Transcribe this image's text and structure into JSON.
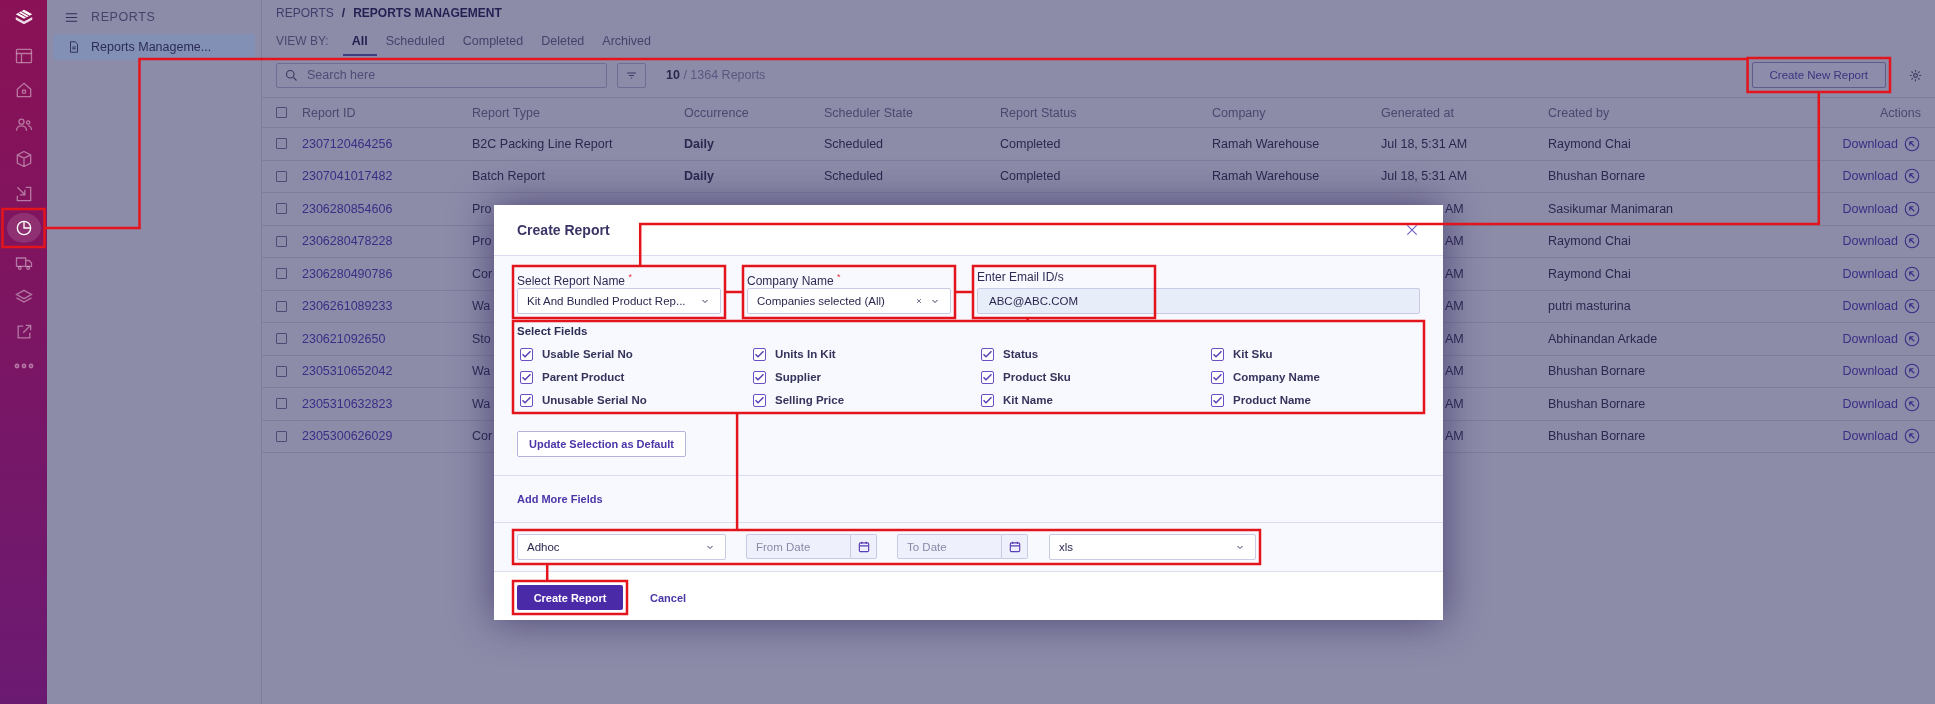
{
  "nav_rail": {
    "icons": [
      {
        "selected": false,
        "highlighted": false
      },
      {
        "selected": false,
        "highlighted": false
      },
      {
        "selected": false,
        "highlighted": false
      },
      {
        "selected": false,
        "highlighted": false
      },
      {
        "selected": false,
        "highlighted": false
      },
      {
        "selected": true,
        "highlighted": true
      },
      {
        "selected": false,
        "highlighted": false
      },
      {
        "selected": false,
        "highlighted": false
      },
      {
        "selected": false,
        "highlighted": false
      },
      {
        "selected": false,
        "highlighted": false
      }
    ]
  },
  "subnav": {
    "title": "REPORTS",
    "items": [
      {
        "label": "Reports Manageme...",
        "selected": true
      }
    ]
  },
  "breadcrumb": {
    "items": [
      "REPORTS",
      "REPORTS MANAGEMENT"
    ],
    "separator": "/"
  },
  "view_by": {
    "label": "VIEW BY:",
    "tabs": [
      {
        "label": "All",
        "selected": true
      },
      {
        "label": "Scheduled",
        "selected": false
      },
      {
        "label": "Completed",
        "selected": false
      },
      {
        "label": "Deleted",
        "selected": false
      },
      {
        "label": "Archived",
        "selected": false
      }
    ]
  },
  "toolbar": {
    "search": {
      "placeholder": "Search here"
    },
    "count": "**10** / 1364 Reports",
    "create_button": {
      "label": "Create New Report",
      "highlighted": true
    }
  },
  "table": {
    "header_checked": false,
    "columns": [
      "Report ID",
      "Report Type",
      "Occurrence",
      "Scheduler State",
      "Report Status",
      "Company",
      "Generated at",
      "Created by",
      "Actions"
    ],
    "rows": [
      {
        "checked": false,
        "covered": false,
        "id": "2307120464256",
        "type": "B2C Packing Line Report",
        "occurrence": "Daily",
        "scheduler_state": "Scheduled",
        "status": "Completed",
        "company": "Ramah Warehouse",
        "generated_at": "Jul 18, 5:31 AM",
        "created_by": "Raymond Chai",
        "action": "Download"
      },
      {
        "checked": false,
        "covered": false,
        "id": "2307041017482",
        "type": "Batch Report",
        "occurrence": "Daily",
        "scheduler_state": "Scheduled",
        "status": "Completed",
        "company": "Ramah Warehouse",
        "generated_at": "Jul 18, 5:31 AM",
        "created_by": "Bhushan Bornare",
        "action": "Download"
      },
      {
        "checked": false,
        "covered": true,
        "id": "2306280854606",
        "type": "Pro",
        "generated_at": "AM",
        "created_by": "Sasikumar Manimaran",
        "action": "Download"
      },
      {
        "checked": false,
        "covered": true,
        "id": "2306280478228",
        "type": "Pro",
        "generated_at": "AM",
        "created_by": "Raymond Chai",
        "action": "Download"
      },
      {
        "checked": false,
        "covered": true,
        "id": "2306280490786",
        "type": "Cor",
        "generated_at": "AM",
        "created_by": "Raymond Chai",
        "action": "Download"
      },
      {
        "checked": false,
        "covered": true,
        "id": "2306261089233",
        "type": "Wa",
        "generated_at": "AM",
        "created_by": "putri masturina",
        "action": "Download"
      },
      {
        "checked": false,
        "covered": true,
        "id": "230621092650",
        "type": "Sto",
        "generated_at": "AM",
        "created_by": "Abhinandan Arkade",
        "action": "Download"
      },
      {
        "checked": false,
        "covered": true,
        "id": "2305310652042",
        "type": "Wa",
        "generated_at": "AM",
        "created_by": "Bhushan Bornare",
        "action": "Download"
      },
      {
        "checked": false,
        "covered": true,
        "id": "2305310632823",
        "type": "Wa",
        "generated_at": "AM",
        "created_by": "Bhushan Bornare",
        "action": "Download"
      },
      {
        "checked": false,
        "covered": true,
        "id": "2305300626029",
        "type": "Cor",
        "generated_at": "AM",
        "created_by": "Bhushan Bornare",
        "action": "Download"
      }
    ]
  },
  "modal": {
    "title": "Create Report",
    "fields": [
      {
        "kind": "select",
        "label": "Select Report Name $^{*}$",
        "value": "Kit And Bundled Product Rep...",
        "highlighted": true
      },
      {
        "kind": "multiselect",
        "label": "Company Name $^{*}$",
        "value": "Companies selected (All)",
        "highlighted": true
      },
      {
        "kind": "text",
        "label": "Enter Email ID/s",
        "value": "ABC@ABC.COM",
        "highlighted": true
      }
    ],
    "select_fields": {
      "title": "Select Fields",
      "highlighted": true,
      "options": [
        {
          "label": "Usable Serial No",
          "checked": true
        },
        {
          "label": "Units In Kit",
          "checked": true
        },
        {
          "label": "Status",
          "checked": true
        },
        {
          "label": "Kit Sku",
          "checked": true
        },
        {
          "label": "Parent Product",
          "checked": true
        },
        {
          "label": "Supplier",
          "checked": true
        },
        {
          "label": "Product Sku",
          "checked": true
        },
        {
          "label": "Company Name",
          "checked": true
        },
        {
          "label": "Unusable Serial No",
          "checked": true
        },
        {
          "label": "Selling Price",
          "checked": true
        },
        {
          "label": "Kit Name",
          "checked": true
        },
        {
          "label": "Product Name",
          "checked": true
        }
      ]
    },
    "update_button": "Update Selection as Default",
    "add_more": "Add More Fields",
    "schedule_row": {
      "highlighted": true,
      "controls": [
        {
          "kind": "select",
          "value": "Adhoc"
        },
        {
          "kind": "date",
          "placeholder": "From Date"
        },
        {
          "kind": "date",
          "placeholder": "To Date"
        },
        {
          "kind": "select",
          "value": "xls"
        }
      ]
    },
    "submit": {
      "label": "Create Report",
      "highlighted": true
    },
    "cancel": "Cancel"
  }
}
